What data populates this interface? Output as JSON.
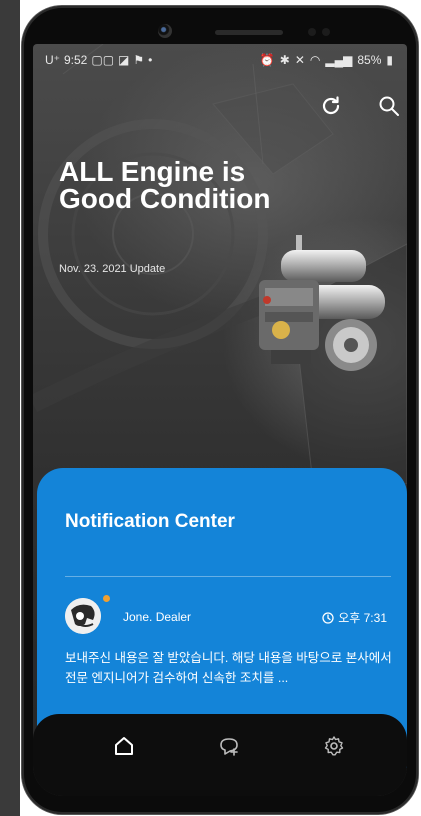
{
  "status": {
    "time": "9:52",
    "carrier": "U⁺",
    "battery": "85%"
  },
  "header": {
    "refresh_icon": "refresh-icon",
    "search_icon": "search-icon"
  },
  "hero": {
    "title": "ALL Engine is Good Condition",
    "updated": "Nov. 23. 2021 Update"
  },
  "notification_center": {
    "title": "Notification Center",
    "items": [
      {
        "sender": "Jone. Dealer",
        "time": "오후 7:31",
        "message": "보내주신 내용은 잘 받았습니다. 해당 내용을 바탕으로 본사에서 전문 엔지니어가 검수하여 신속한 조치를 ..."
      }
    ]
  },
  "bottom_nav": {
    "items": [
      "home-icon",
      "chat-add-icon",
      "settings-icon"
    ]
  },
  "colors": {
    "card_blue": "#1484d8",
    "unread_dot": "#f0a030",
    "nav_bg": "#0d0d0d"
  }
}
